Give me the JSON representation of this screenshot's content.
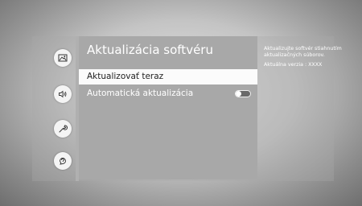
{
  "sidebar": {
    "items": [
      {
        "icon": "picture-icon"
      },
      {
        "icon": "sound-icon"
      },
      {
        "icon": "wrench-icon"
      },
      {
        "icon": "support-icon"
      }
    ]
  },
  "menu": {
    "title": "Aktualizácia softvéru",
    "items": [
      {
        "label": "Aktualizovať teraz",
        "selected": true
      },
      {
        "label": "Automatická aktualizácia",
        "toggle": "off"
      }
    ]
  },
  "info": {
    "description": "Aktualizujte softvér stiahnutím aktualizačných súborov.",
    "version": "Aktuálna verzia : XXXX"
  }
}
